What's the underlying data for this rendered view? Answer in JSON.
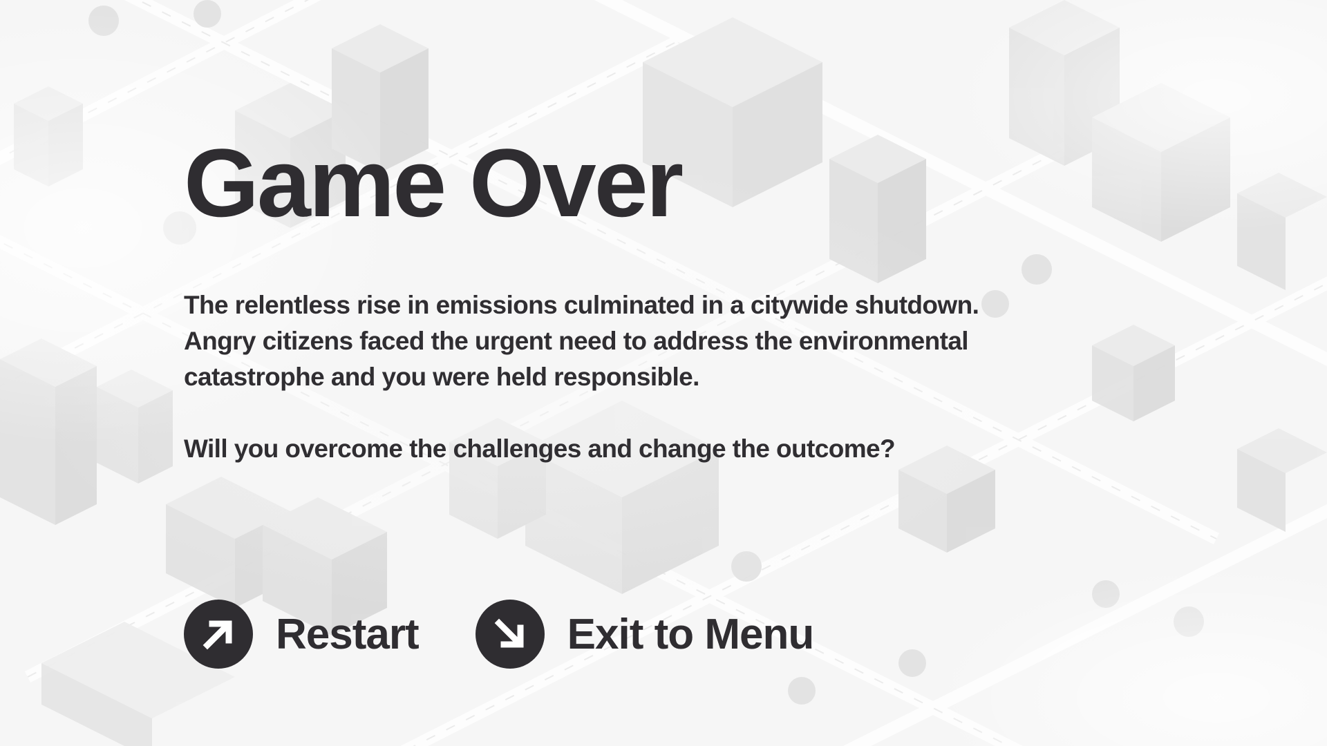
{
  "screen": {
    "title": "Game Over",
    "message_paragraphs": [
      "The relentless rise in emissions culminated in a citywide shutdown. Angry citizens faced the urgent need to address the environmental catastrophe and you were held responsible.",
      "Will you overcome the challenges and change the outcome?"
    ]
  },
  "actions": {
    "restart": {
      "label": "Restart",
      "icon": "arrow-up-right-icon"
    },
    "exit": {
      "label": "Exit to Menu",
      "icon": "arrow-down-right-icon"
    }
  },
  "colors": {
    "text": "#2f2d31",
    "background": "#f6f6f6",
    "icon_circle": "#2f2d31",
    "icon_arrow": "#ffffff"
  }
}
